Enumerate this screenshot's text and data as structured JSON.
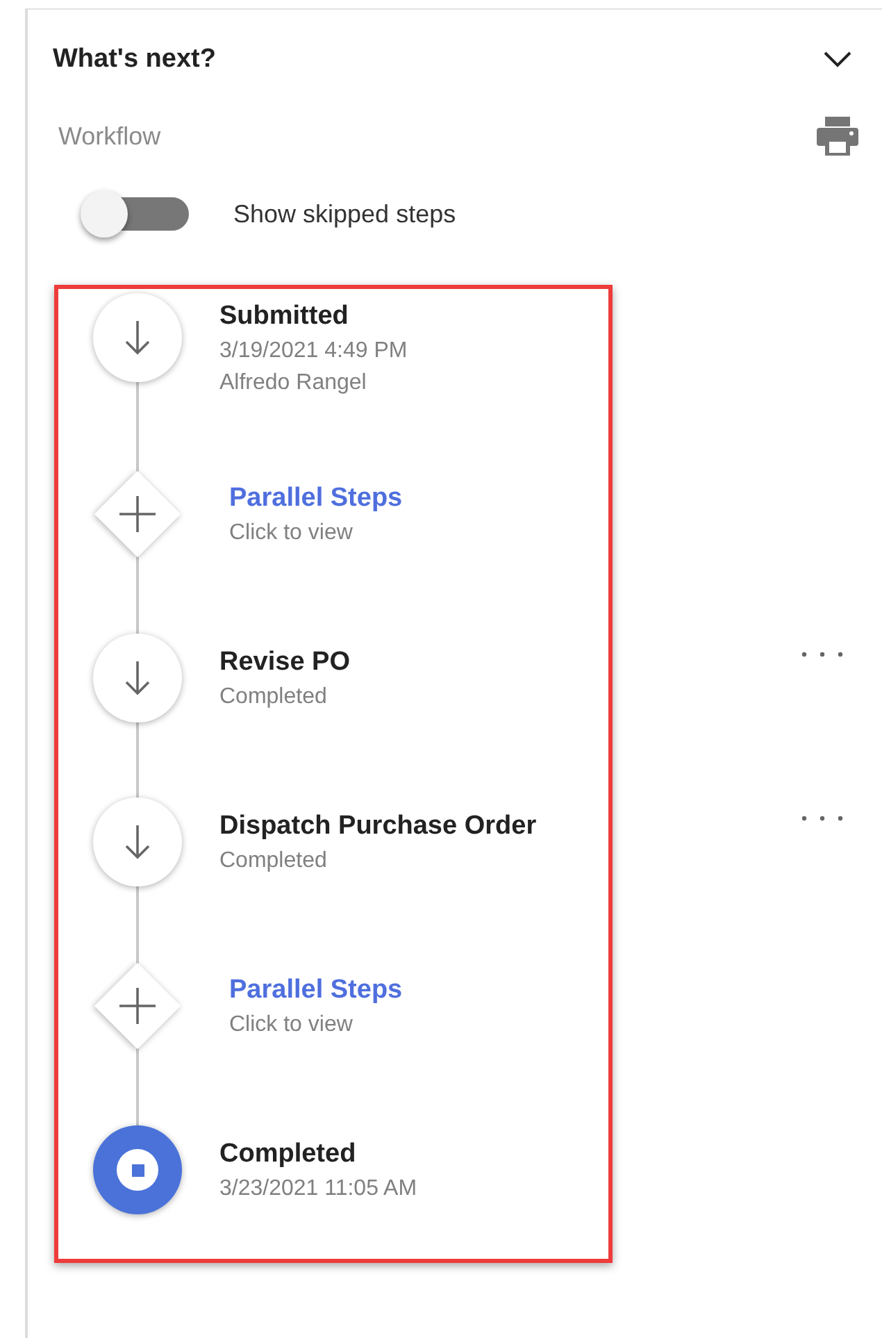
{
  "panel": {
    "title": "What's next?",
    "expanded": true
  },
  "section": {
    "label": "Workflow"
  },
  "toggle": {
    "label": "Show skipped steps",
    "on": false
  },
  "steps": [
    {
      "kind": "step",
      "title": "Submitted",
      "lines": [
        "3/19/2021 4:49 PM",
        "Alfredo Rangel"
      ],
      "menu": false
    },
    {
      "kind": "parallel",
      "title": "Parallel Steps",
      "lines": [
        "Click to view"
      ],
      "menu": false
    },
    {
      "kind": "step",
      "title": "Revise PO",
      "lines": [
        "Completed"
      ],
      "menu": true
    },
    {
      "kind": "step",
      "title": "Dispatch Purchase Order",
      "lines": [
        "Completed"
      ],
      "menu": true
    },
    {
      "kind": "parallel",
      "title": "Parallel Steps",
      "lines": [
        "Click to view"
      ],
      "menu": false
    },
    {
      "kind": "end",
      "title": "Completed",
      "lines": [
        "3/23/2021 11:05 AM"
      ],
      "menu": false
    }
  ]
}
